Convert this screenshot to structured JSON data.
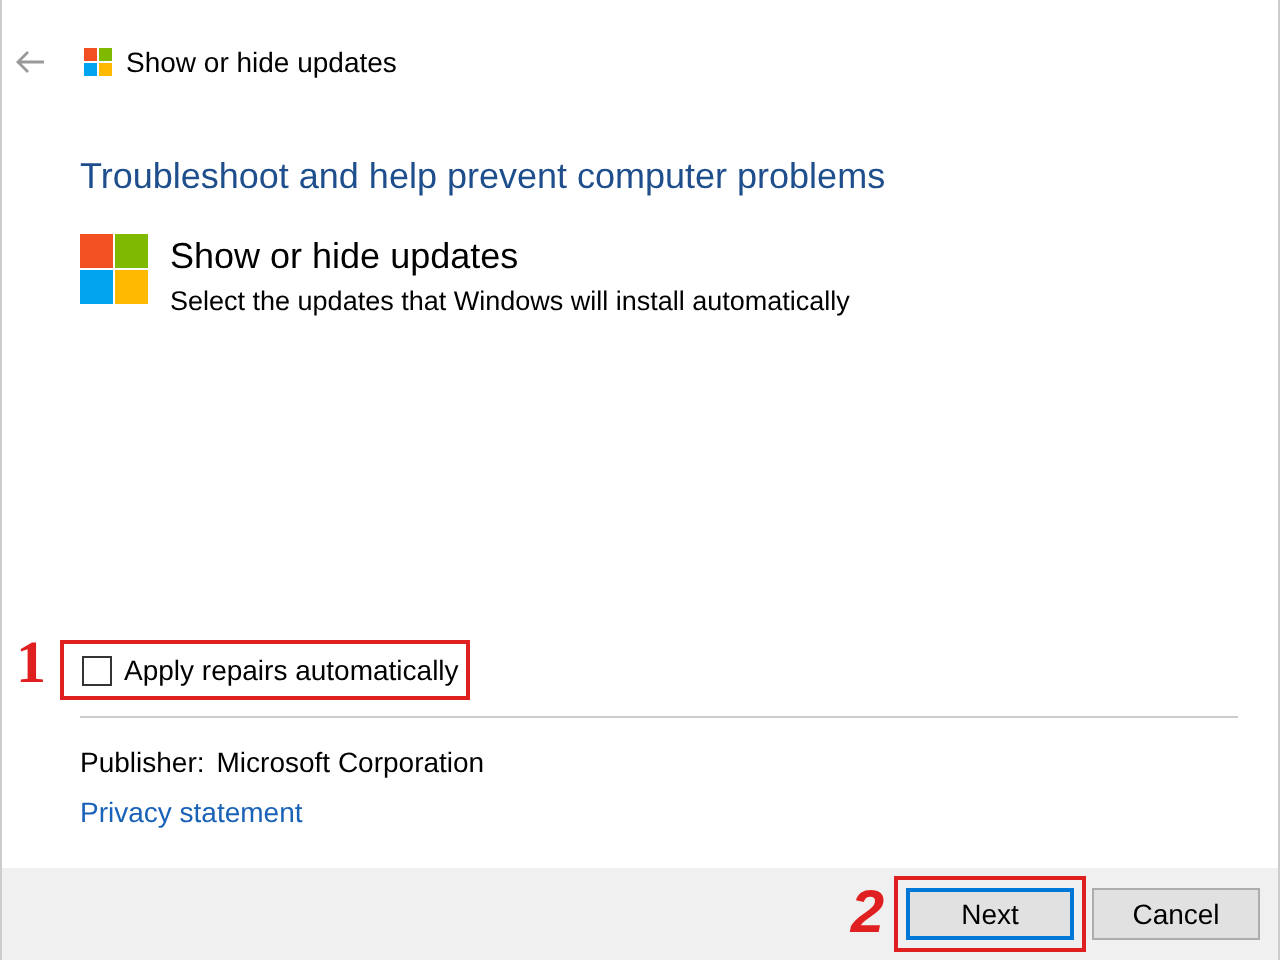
{
  "window": {
    "title": "Show or hide updates"
  },
  "heading": "Troubleshoot and help prevent computer problems",
  "tool": {
    "title": "Show or hide updates",
    "description": "Select the updates that Windows will install automatically"
  },
  "apply_repairs": {
    "label": "Apply repairs automatically",
    "checked": false
  },
  "publisher": {
    "label": "Publisher:",
    "value": "Microsoft Corporation"
  },
  "privacy_link": "Privacy statement",
  "buttons": [
    {
      "label": "Next",
      "kind": "default"
    },
    {
      "label": "Cancel",
      "kind": "normal"
    }
  ],
  "annotations": [
    {
      "number": "1"
    },
    {
      "number": "2"
    }
  ]
}
